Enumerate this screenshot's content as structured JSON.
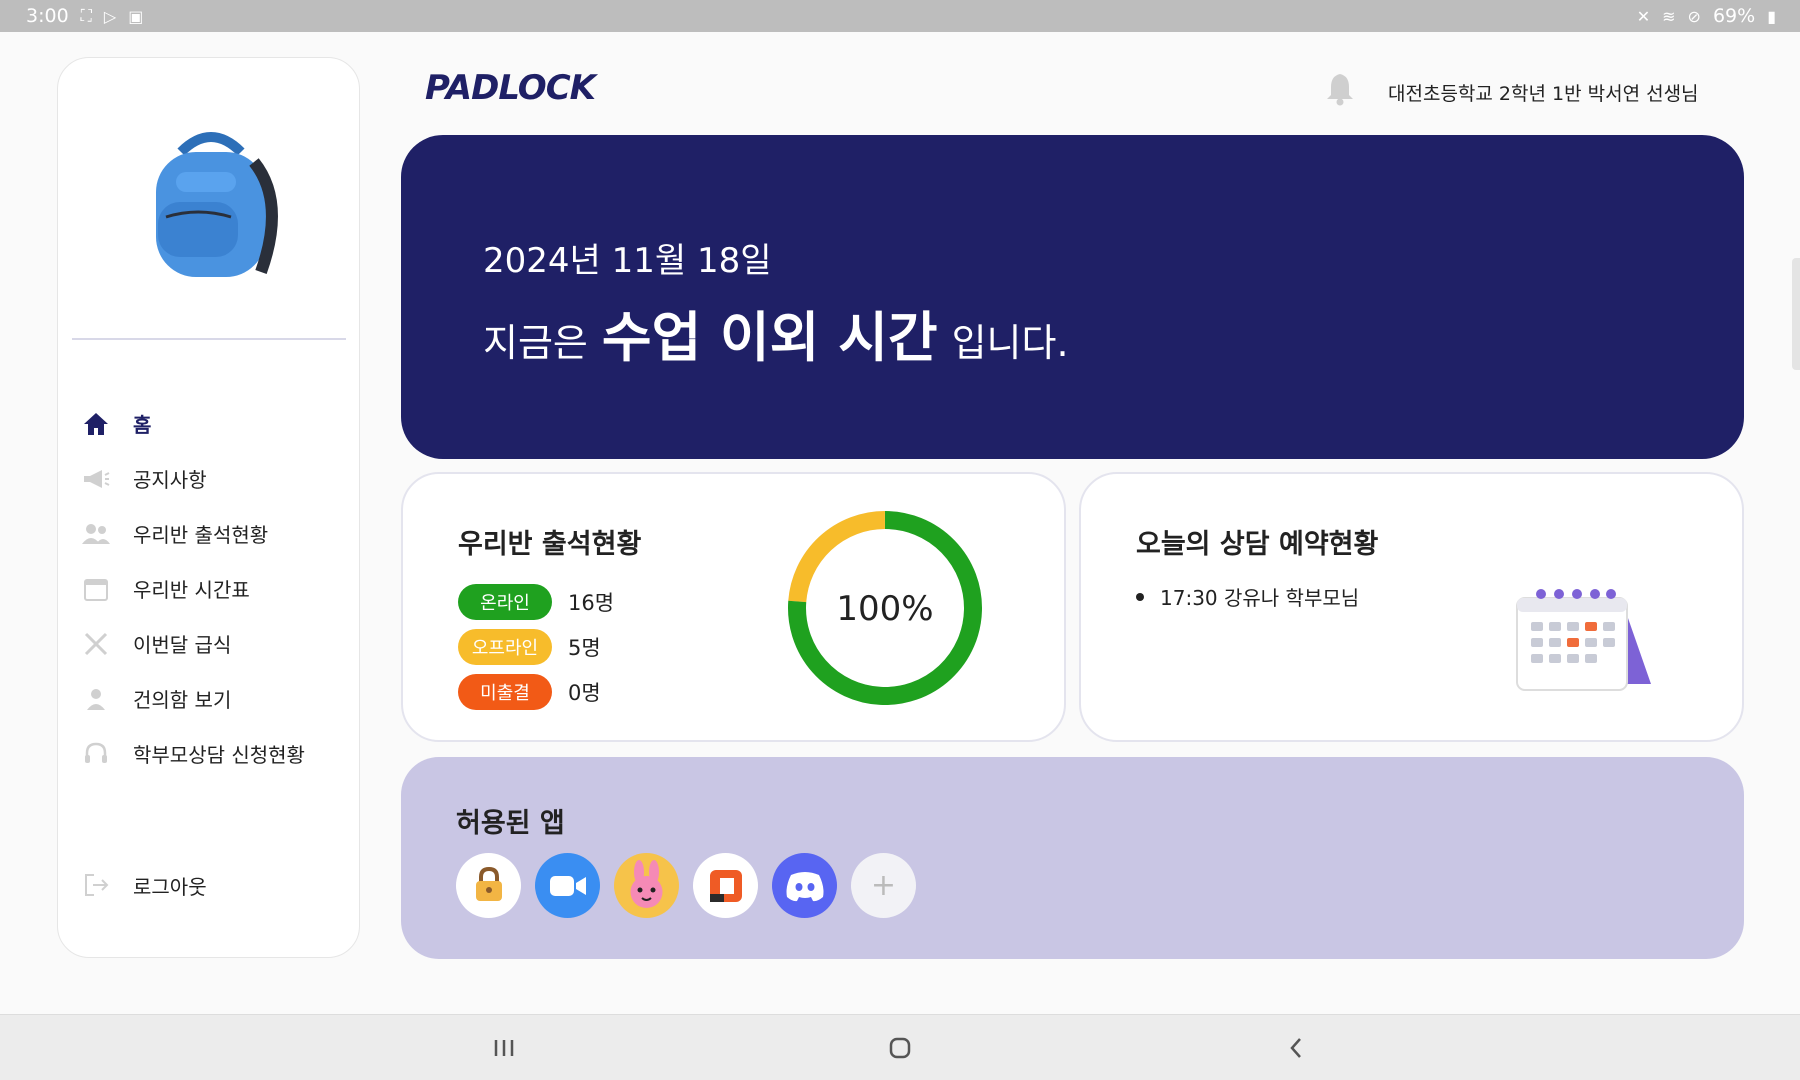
{
  "status_bar": {
    "time": "3:00",
    "battery": "69%"
  },
  "sidebar": {
    "items": [
      {
        "label": "홈",
        "icon": "home-icon",
        "active": true
      },
      {
        "label": "공지사항",
        "icon": "megaphone-icon"
      },
      {
        "label": "우리반 출석현황",
        "icon": "people-icon"
      },
      {
        "label": "우리반 시간표",
        "icon": "calendar-icon"
      },
      {
        "label": "이번달 급식",
        "icon": "utensils-icon"
      },
      {
        "label": "건의함 보기",
        "icon": "person-icon"
      },
      {
        "label": "학부모상담 신청현황",
        "icon": "headset-icon"
      }
    ],
    "logout_label": "로그아웃"
  },
  "header": {
    "logo": "PADLOCK",
    "teacher_name": "대전초등학교 2학년 1반 박서연 선생님"
  },
  "banner": {
    "date": "2024년 11월 18일",
    "prefix": "지금은",
    "highlight": "수업 이외 시간",
    "suffix": "입니다."
  },
  "attendance": {
    "title": "우리반 출석현황",
    "rows": [
      {
        "label": "온라인",
        "count": "16명",
        "color": "#1fa11f"
      },
      {
        "label": "오프라인",
        "count": "5명",
        "color": "#f7bc2b"
      },
      {
        "label": "미출결",
        "count": "0명",
        "color": "#f25a16"
      }
    ],
    "percent_text": "100%",
    "donut": {
      "online": 16,
      "offline": 5,
      "absent": 0
    }
  },
  "consult": {
    "title": "오늘의 상담 예약현황",
    "items": [
      "17:30 강유나 학부모님"
    ]
  },
  "apps": {
    "title": "허용된 앱",
    "list": [
      "padlock",
      "zoom",
      "game",
      "office",
      "discord"
    ],
    "add_symbol": "+"
  },
  "colors": {
    "brand": "#1f2066",
    "online": "#1fa11f",
    "offline": "#f7bc2b",
    "absent": "#f25a16"
  }
}
